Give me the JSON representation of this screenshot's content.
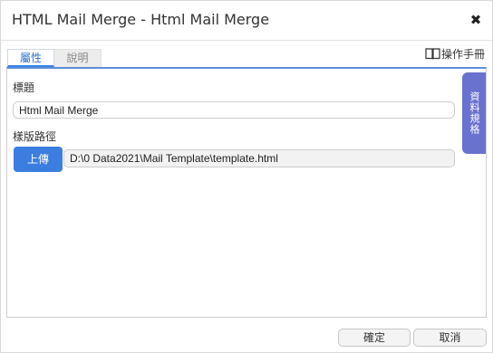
{
  "window": {
    "title": "HTML Mail Merge - Html Mail Merge",
    "close_glyph": "✖"
  },
  "toolbar": {
    "manual_label": "操作手冊",
    "manual_icon": "book-icon"
  },
  "tabs": [
    {
      "label": "屬性",
      "active": true
    },
    {
      "label": "說明",
      "active": false
    }
  ],
  "form": {
    "title_label": "標題",
    "title_value": "Html Mail Merge",
    "path_label": "樣版路徑",
    "upload_label": "上傳",
    "path_value": "D:\\0 Data2021\\Mail Template\\template.html"
  },
  "side_tab": {
    "label": "資料規格"
  },
  "footer": {
    "ok_label": "確定",
    "cancel_label": "取消"
  },
  "colors": {
    "primary_button": "#3c7de0",
    "active_tab_text": "#2f6fd1",
    "side_tab": "#6a72cf",
    "panel_top_border": "#5b8ed8"
  }
}
